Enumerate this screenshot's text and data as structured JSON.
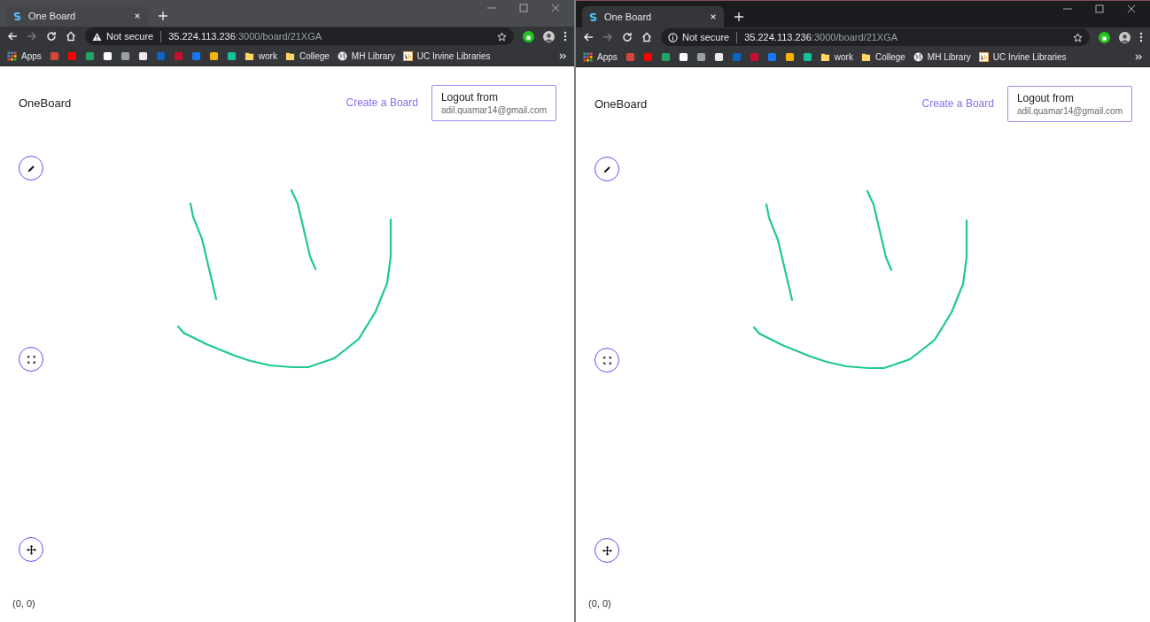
{
  "windows": [
    {
      "active": false,
      "tab_title": "One Board",
      "security": {
        "kind": "warning",
        "label": "Not secure"
      },
      "url_host": "35.224.113.236",
      "url_path": ":3000/board/21XGA",
      "bookmarks": [
        {
          "kind": "apps",
          "label": "Apps"
        },
        {
          "kind": "folder",
          "label": "work"
        },
        {
          "kind": "folder",
          "label": "College"
        },
        {
          "kind": "globe",
          "label": "MH Library"
        },
        {
          "kind": "lib",
          "label": "UC Irvine Libraries"
        }
      ],
      "app": {
        "logo": "OneBoard",
        "create_link": "Create a Board",
        "logout_label": "Logout from",
        "logout_email": "adil.quamar14@gmail.com",
        "coords": "(0, 0)"
      }
    },
    {
      "active": true,
      "tab_title": "One Board",
      "security": {
        "kind": "info",
        "label": "Not secure"
      },
      "url_host": "35.224.113.236",
      "url_path": ":3000/board/21XGA",
      "bookmarks": [
        {
          "kind": "apps",
          "label": "Apps"
        },
        {
          "kind": "folder",
          "label": "work"
        },
        {
          "kind": "folder",
          "label": "College"
        },
        {
          "kind": "globe",
          "label": "MH Library"
        },
        {
          "kind": "lib",
          "label": "UC Irvine Libraries"
        }
      ],
      "app": {
        "logo": "OneBoard",
        "create_link": "Create a Board",
        "logout_label": "Logout from",
        "logout_email": "adil.quamar14@gmail.com",
        "coords": "(0, 0)"
      }
    }
  ]
}
